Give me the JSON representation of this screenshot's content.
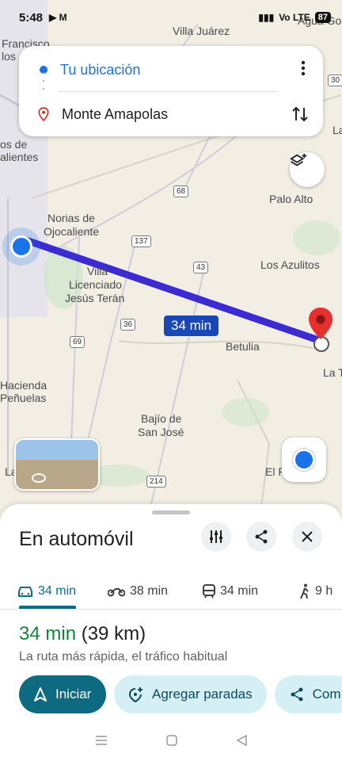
{
  "status": {
    "time": "5:48",
    "battery": "87",
    "network": "Vo LTE"
  },
  "search": {
    "origin": "Tu ubicación",
    "destination": "Monte Amapolas"
  },
  "map": {
    "places": [
      "Villa Juárez",
      "Francisco",
      "los",
      "os de",
      "alientes",
      "Palo Alto",
      "Norias de",
      "Ojocaliente",
      "Los Azulitos",
      "Villa",
      "Licenciado",
      "Jesús Terán",
      "Betulia",
      "La T",
      "Hacienda",
      "Peñuelas",
      "Bajío de",
      "San José",
      "El P",
      "La",
      "Agua Go",
      "La"
    ],
    "roads": [
      "68",
      "137",
      "43",
      "36",
      "69",
      "214",
      "30"
    ],
    "route_time": "34 min",
    "route_color": "#3b2bd1"
  },
  "sheet": {
    "title": "En automóvil",
    "tabs": [
      {
        "mode": "car-icon",
        "label": "34 min"
      },
      {
        "mode": "motorcycle-icon",
        "label": "38 min"
      },
      {
        "mode": "transit-icon",
        "label": "34 min"
      },
      {
        "mode": "walk-icon",
        "label": "9 h"
      }
    ],
    "eta_time": "34 min",
    "eta_distance": "(39 km)",
    "description": "La ruta más rápida, el tráfico habitual",
    "start": "Iniciar",
    "add_stops": "Agregar paradas",
    "share": "Com"
  },
  "colors": {
    "accent": "#0e6a80",
    "eta": "#188038",
    "origin": "#1a73e8"
  }
}
